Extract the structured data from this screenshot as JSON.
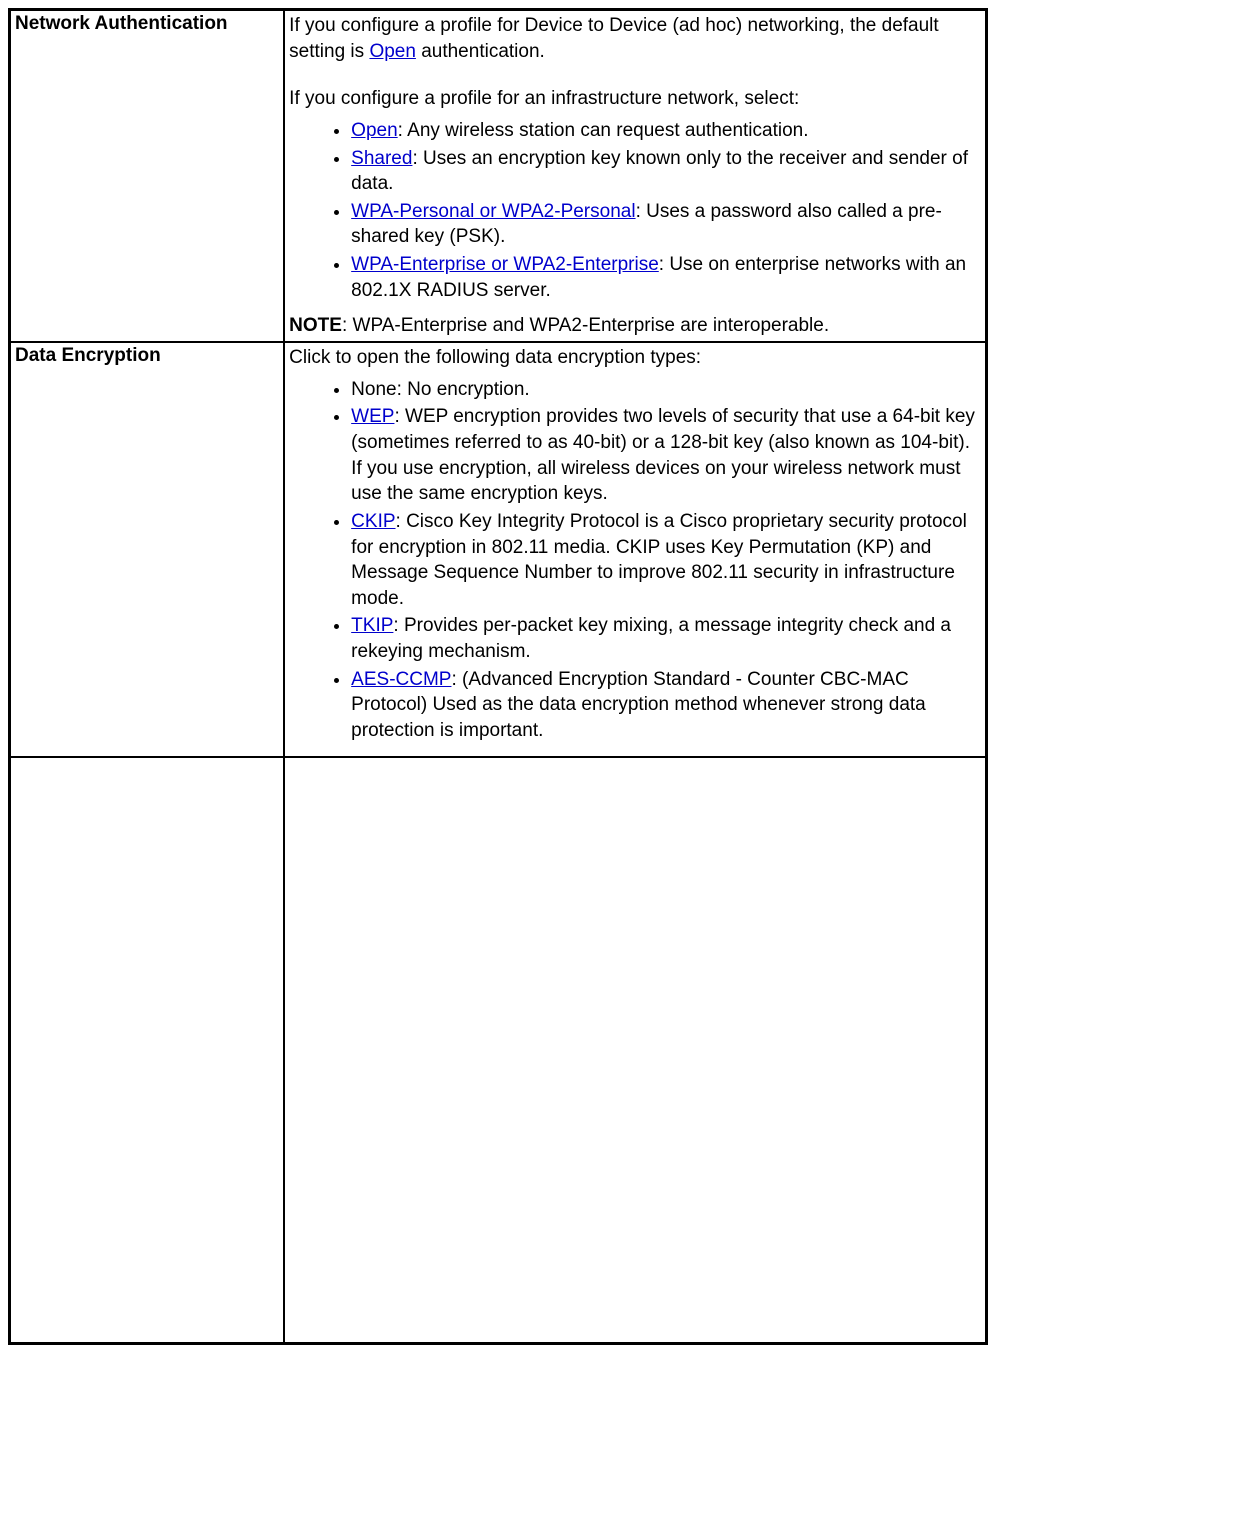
{
  "rows": {
    "networkAuth": {
      "label": "Network Authentication",
      "intro_part1": "If you configure a profile for Device to Device (ad hoc) networking, the default setting is ",
      "intro_link": "Open",
      "intro_part2": " authentication.",
      "infra_intro": "If you configure a profile for an infrastructure network, select:",
      "items": [
        {
          "link": "Open",
          "text": ": Any wireless station can request authentication."
        },
        {
          "link": "Shared",
          "text": ": Uses an encryption key known only to the receiver and sender of data."
        },
        {
          "link": "WPA-Personal or WPA2-Personal",
          "text": ": Uses a password also called a pre-shared key (PSK)."
        },
        {
          "link": "WPA-Enterprise or WPA2-Enterprise",
          "text": ": Use on enterprise networks with an 802.1X RADIUS server."
        }
      ],
      "note_label": "NOTE",
      "note_text": ": WPA-Enterprise and WPA2-Enterprise are interoperable."
    },
    "dataEnc": {
      "label": "Data Encryption",
      "intro": "Click to open the following data encryption types:",
      "items": [
        {
          "link": "",
          "plain": "None",
          "text": ": No encryption."
        },
        {
          "link": "WEP",
          "plain": "",
          "text": ": WEP encryption provides two levels of security that use a 64-bit key (sometimes referred to as 40-bit) or a 128-bit key (also known as 104-bit). If you use encryption, all wireless devices on your wireless network must use the same encryption keys."
        },
        {
          "link": "CKIP",
          "plain": "",
          "text": ": Cisco Key Integrity Protocol is a Cisco proprietary security protocol for encryption in 802.11 media. CKIP uses Key Permutation (KP) and Message Sequence Number to improve 802.11 security in infrastructure mode."
        },
        {
          "link": "TKIP",
          "plain": "",
          "text": ": Provides per-packet key mixing, a message integrity check and a rekeying mechanism."
        },
        {
          "link": "AES-CCMP",
          "plain": "",
          "text": ": (Advanced Encryption Standard - Counter CBC-MAC Protocol) Used as the data encryption method whenever strong data protection is important."
        }
      ]
    }
  }
}
